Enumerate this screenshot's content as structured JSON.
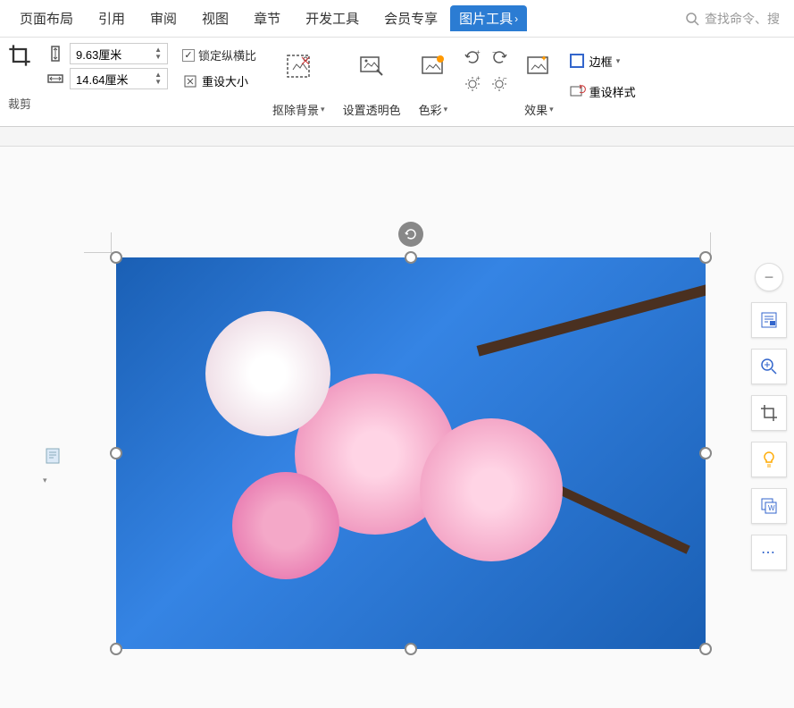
{
  "tabs": {
    "page_layout": "页面布局",
    "reference": "引用",
    "review": "审阅",
    "view": "视图",
    "section": "章节",
    "dev_tools": "开发工具",
    "member": "会员专享",
    "image_tools": "图片工具"
  },
  "search": {
    "placeholder": "查找命令、搜"
  },
  "ribbon": {
    "crop": "裁剪",
    "height_value": "9.63厘米",
    "width_value": "14.64厘米",
    "lock_ratio": "锁定纵横比",
    "reset_size": "重设大小",
    "remove_bg": "抠除背景",
    "set_transparent": "设置透明色",
    "color": "色彩",
    "effects": "效果",
    "border": "边框",
    "reset_style": "重设样式"
  },
  "side": {
    "minus": "−",
    "more": "⋯"
  }
}
